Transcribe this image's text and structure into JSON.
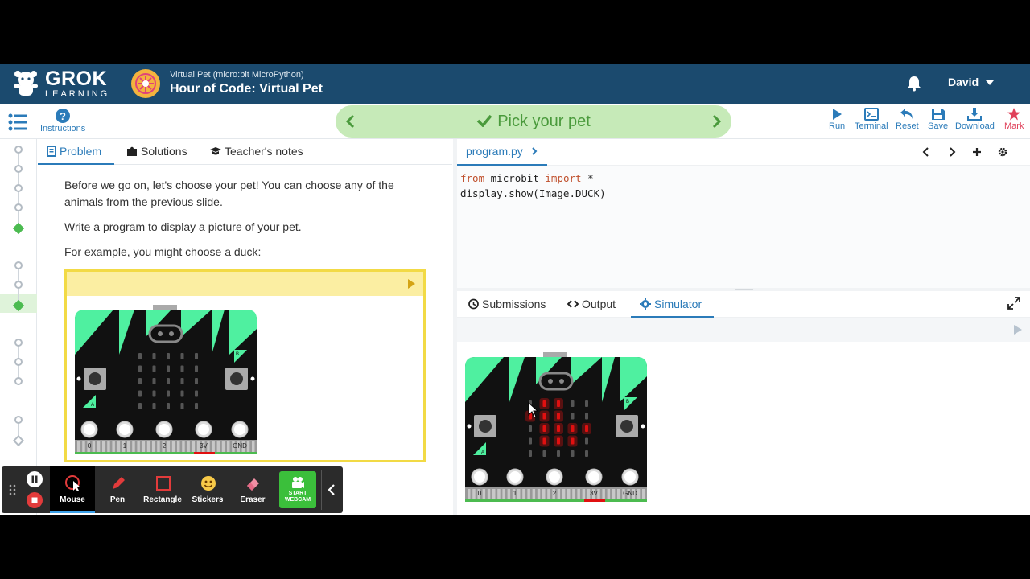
{
  "header": {
    "logo_main": "GROK",
    "logo_sub": "LEARNING",
    "course_subtitle": "Virtual Pet (micro:bit MicroPython)",
    "course_title": "Hour of Code: Virtual Pet",
    "user_name": "David"
  },
  "toolbar": {
    "instructions_label": "Instructions",
    "step_title": "Pick your pet",
    "run_label": "Run",
    "terminal_label": "Terminal",
    "reset_label": "Reset",
    "save_label": "Save",
    "download_label": "Download",
    "mark_label": "Mark"
  },
  "problem": {
    "tabs": [
      {
        "label": "Problem"
      },
      {
        "label": "Solutions"
      },
      {
        "label": "Teacher's notes"
      }
    ],
    "paragraphs": [
      "Before we go on, let's choose your pet! You can choose any of the animals from the previous slide.",
      "Write a program to display a picture of your pet.",
      "For example, you might choose a duck:"
    ]
  },
  "editor": {
    "filename": "program.py",
    "code": {
      "kw_from": "from",
      "module": "microbit",
      "kw_import": "import",
      "star": "*",
      "line2": "display.show(Image.DUCK)"
    },
    "output_tabs": [
      {
        "label": "Submissions"
      },
      {
        "label": "Output"
      },
      {
        "label": "Simulator"
      }
    ]
  },
  "microbit": {
    "pins": [
      "0",
      "1",
      "2",
      "3V",
      "GND"
    ],
    "button_a": "A",
    "button_b": "B",
    "duck_pattern": [
      [
        0,
        1,
        1,
        0,
        0
      ],
      [
        1,
        1,
        1,
        0,
        0
      ],
      [
        0,
        1,
        1,
        1,
        1
      ],
      [
        0,
        1,
        1,
        1,
        0
      ],
      [
        0,
        0,
        0,
        0,
        0
      ]
    ]
  },
  "recorder": {
    "tools": [
      {
        "label": "Mouse"
      },
      {
        "label": "Pen"
      },
      {
        "label": "Rectangle"
      },
      {
        "label": "Stickers"
      },
      {
        "label": "Eraser"
      }
    ],
    "webcam_line1": "START",
    "webcam_line2": "WEBCAM"
  },
  "colors": {
    "header_bg": "#1b4a6e",
    "accent_blue": "#2b7bb9",
    "stepper_bg": "#c6eab8",
    "stepper_text": "#4a9a3c",
    "led_on": "#e01010",
    "board_green": "#4ff0a0",
    "mark_red": "#e0405a"
  }
}
